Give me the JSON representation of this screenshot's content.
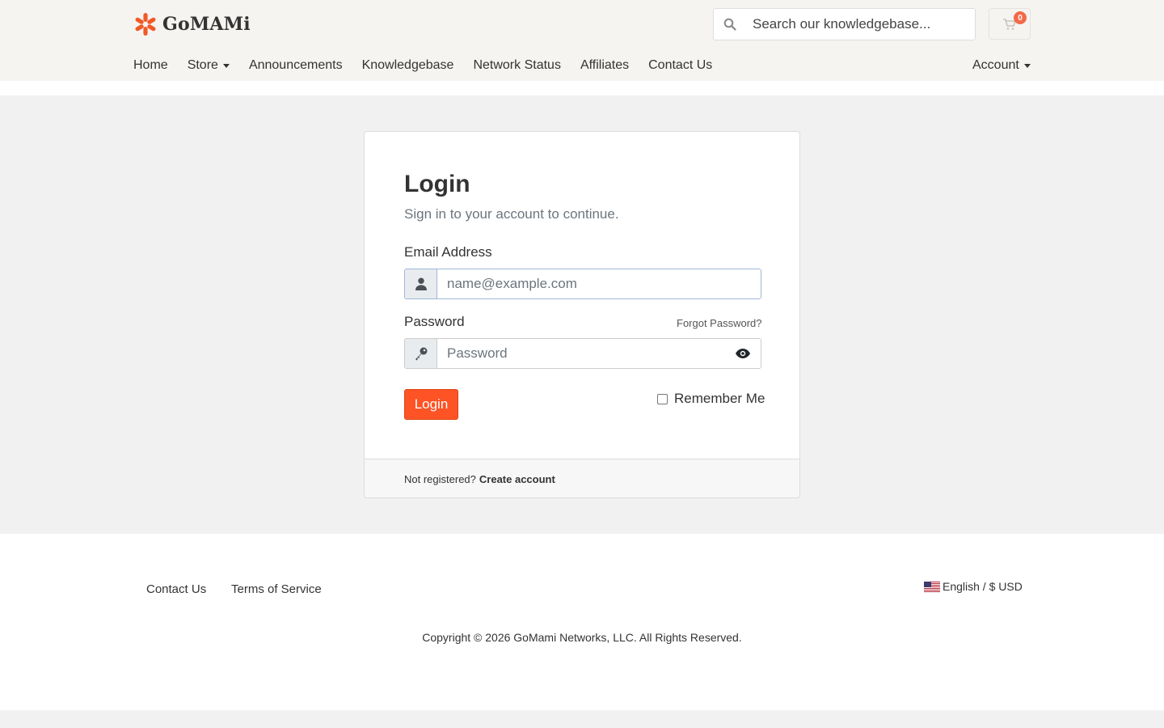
{
  "brand": {
    "name": "GoMAMi",
    "accent": "#fd5325"
  },
  "search": {
    "placeholder": "Search our knowledgebase...",
    "icon": "search-icon"
  },
  "cart": {
    "count": "0",
    "icon": "cart-icon"
  },
  "nav": {
    "items": [
      {
        "label": "Home",
        "dropdown": false
      },
      {
        "label": "Store",
        "dropdown": true
      },
      {
        "label": "Announcements",
        "dropdown": false
      },
      {
        "label": "Knowledgebase",
        "dropdown": false
      },
      {
        "label": "Network Status",
        "dropdown": false
      },
      {
        "label": "Affiliates",
        "dropdown": false
      },
      {
        "label": "Contact Us",
        "dropdown": false
      }
    ],
    "account": "Account"
  },
  "login": {
    "title": "Login",
    "subtitle": "Sign in to your account to continue.",
    "email_label": "Email Address",
    "email_placeholder": "name@example.com",
    "password_label": "Password",
    "forgot": "Forgot Password?",
    "password_placeholder": "Password",
    "submit": "Login",
    "remember": "Remember Me",
    "not_registered": "Not registered?",
    "create_account": "Create account"
  },
  "footer": {
    "links": [
      "Contact Us",
      "Terms of Service"
    ],
    "language": "English / $ USD",
    "copyright": "Copyright © 2026 GoMami Networks, LLC. All Rights Reserved."
  }
}
